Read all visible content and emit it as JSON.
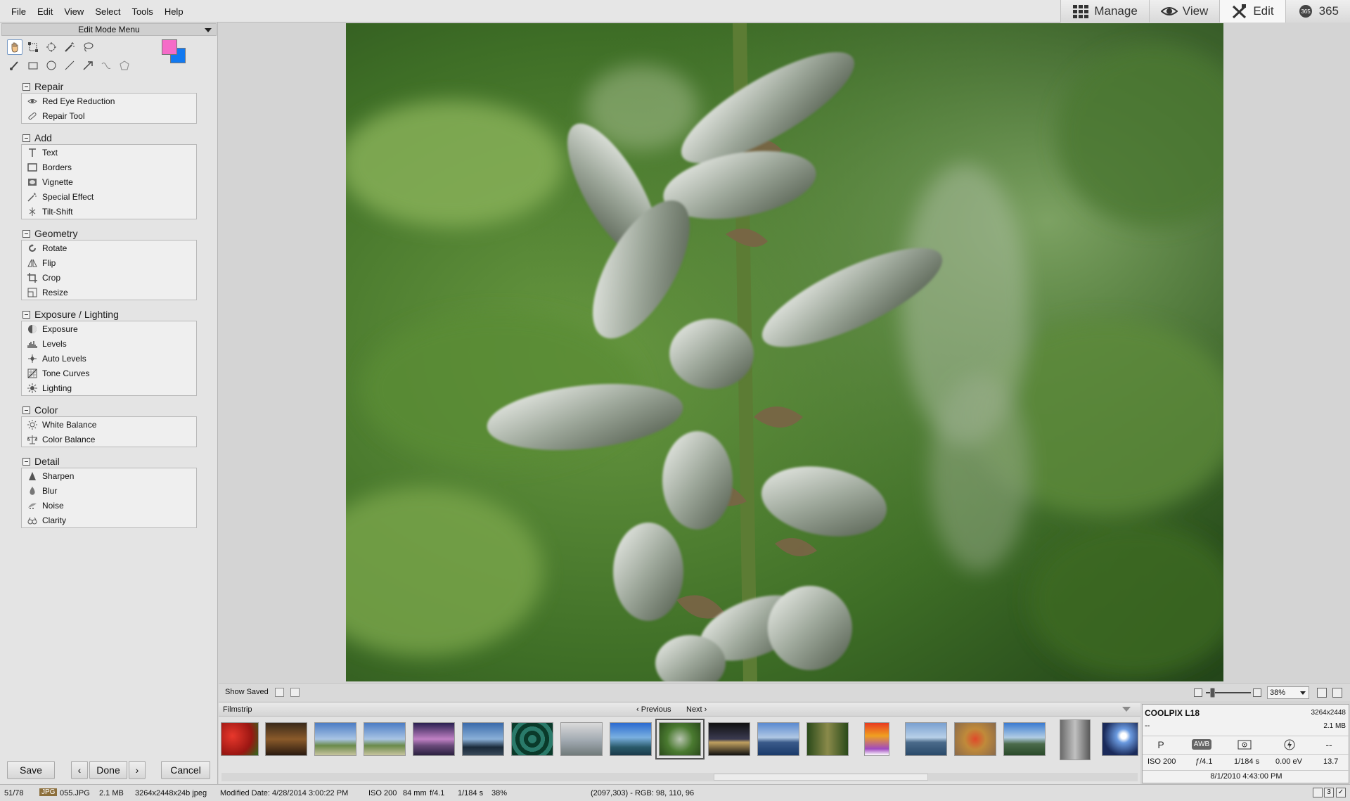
{
  "menu": [
    "File",
    "Edit",
    "View",
    "Select",
    "Tools",
    "Help"
  ],
  "modes": [
    {
      "label": "Manage",
      "icon": "grid-icon"
    },
    {
      "label": "View",
      "icon": "eye-icon"
    },
    {
      "label": "Edit",
      "icon": "edit-tools-icon"
    },
    {
      "label": "365",
      "icon": "365-icon"
    }
  ],
  "active_mode": "Edit",
  "panel": {
    "title": "Edit Mode Menu",
    "sections": [
      {
        "title": "Repair",
        "items": [
          {
            "label": "Red Eye Reduction",
            "icon": "eye-icon"
          },
          {
            "label": "Repair Tool",
            "icon": "bandage-icon"
          }
        ]
      },
      {
        "title": "Add",
        "items": [
          {
            "label": "Text",
            "icon": "text-icon"
          },
          {
            "label": "Borders",
            "icon": "border-icon"
          },
          {
            "label": "Vignette",
            "icon": "vignette-icon"
          },
          {
            "label": "Special Effect",
            "icon": "magic-wand-icon"
          },
          {
            "label": "Tilt-Shift",
            "icon": "tilt-shift-icon"
          }
        ]
      },
      {
        "title": "Geometry",
        "items": [
          {
            "label": "Rotate",
            "icon": "rotate-icon"
          },
          {
            "label": "Flip",
            "icon": "flip-icon"
          },
          {
            "label": "Crop",
            "icon": "crop-icon"
          },
          {
            "label": "Resize",
            "icon": "resize-icon"
          }
        ]
      },
      {
        "title": "Exposure / Lighting",
        "items": [
          {
            "label": "Exposure",
            "icon": "exposure-icon"
          },
          {
            "label": "Levels",
            "icon": "levels-icon"
          },
          {
            "label": "Auto Levels",
            "icon": "auto-levels-icon"
          },
          {
            "label": "Tone Curves",
            "icon": "tone-curves-icon"
          },
          {
            "label": "Lighting",
            "icon": "lighting-icon"
          }
        ]
      },
      {
        "title": "Color",
        "items": [
          {
            "label": "White Balance",
            "icon": "sun-icon"
          },
          {
            "label": "Color Balance",
            "icon": "balance-icon"
          }
        ]
      },
      {
        "title": "Detail",
        "items": [
          {
            "label": "Sharpen",
            "icon": "sharpen-icon"
          },
          {
            "label": "Blur",
            "icon": "blur-drop-icon"
          },
          {
            "label": "Noise",
            "icon": "noise-icon"
          },
          {
            "label": "Clarity",
            "icon": "clarity-icon"
          }
        ]
      }
    ],
    "colors": {
      "foreground": "#f56bc8",
      "background": "#1279f0"
    }
  },
  "buttons": {
    "save": "Save",
    "done": "Done",
    "cancel": "Cancel",
    "prev": "‹",
    "next": "›"
  },
  "savedbar": {
    "show_saved": "Show Saved",
    "zoom": "38%"
  },
  "filmstrip": {
    "title": "Filmstrip",
    "previous": "Previous",
    "next": "Next"
  },
  "info": {
    "camera": "COOLPIX L18",
    "dimensions": "3264x2448",
    "line2": "--",
    "filesize": "2.1 MB",
    "icons": [
      "P",
      "AWB",
      "metering-icon",
      "flash-off-icon",
      "--"
    ],
    "values": [
      "ISO 200",
      "ƒ/4.1",
      "1/184 s",
      "0.00 eV",
      "13.7"
    ],
    "date": "8/1/2010 4:43:00 PM"
  },
  "status": {
    "position": "51/78",
    "type": "JPG",
    "filename": "055.JPG",
    "size": "2.1 MB",
    "format": "3264x2448x24b jpeg",
    "modified": "Modified Date: 4/28/2014 3:00:22 PM",
    "iso": "ISO 200",
    "focal": "84 mm",
    "aperture": "f/4.1",
    "shutter": "1/184 s",
    "zoom": "38%",
    "pixel": "(2097,303) - RGB: 98, 110, 96",
    "page": "3"
  }
}
